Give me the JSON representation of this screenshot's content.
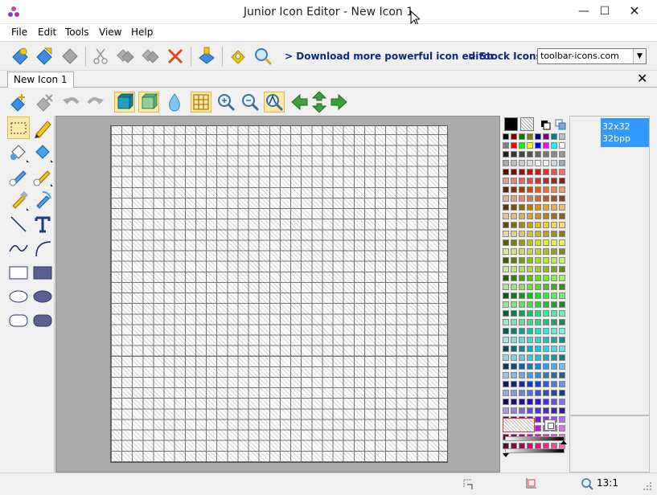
{
  "window": {
    "title": "Junior Icon Editor - New Icon 1",
    "minimize": "—",
    "maximize": "☐",
    "close": "✕"
  },
  "menu": {
    "file": "File",
    "edit": "Edit",
    "tools": "Tools",
    "view": "View",
    "help": "Help"
  },
  "toolbar": {
    "download_link": "> Download more powerful icon editor",
    "stock_link": "> Stock Icons",
    "url_value": "toolbar-icons.com"
  },
  "tabs": {
    "doc_tab": "New Icon 1",
    "close": "✕"
  },
  "formats": {
    "size": "32x32",
    "depth": "32bpp"
  },
  "status": {
    "zoom": "13:1"
  },
  "colors": {
    "accent_selection": "#3399ff",
    "active_tool_fill": "#fde9a6",
    "canvas_background": "#ababab",
    "link_color": "#0c2a8a"
  },
  "icons": {
    "toolbar": [
      "new-icon",
      "open-icon",
      "save-icon",
      "cut-icon",
      "copy-icon",
      "paste-icon",
      "delete-icon",
      "import-icon",
      "keys-icon",
      "search-globe-icon"
    ],
    "edit_toolbar": [
      "paste-new-icon",
      "clear-icon",
      "undo-icon",
      "redo-icon",
      "background-icon",
      "foreground-icon",
      "transparency-drop-icon",
      "grid-icon",
      "zoom-in-icon",
      "zoom-out-icon",
      "zoom-actual-icon",
      "move-left-icon",
      "move-updown-icon",
      "move-right-icon"
    ],
    "tools": [
      "select-rect-icon",
      "pencil-icon",
      "fill-icon",
      "fill-alt-icon",
      "brush-icon",
      "spray-icon",
      "eyedropper-icon",
      "color-replace-icon",
      "line-icon",
      "text-icon",
      "curve-icon",
      "arc-icon",
      "rect-outline-icon",
      "rect-filled-icon",
      "ellipse-outline-icon",
      "ellipse-filled-icon",
      "roundrect-outline-icon",
      "roundrect-filled-icon"
    ]
  }
}
